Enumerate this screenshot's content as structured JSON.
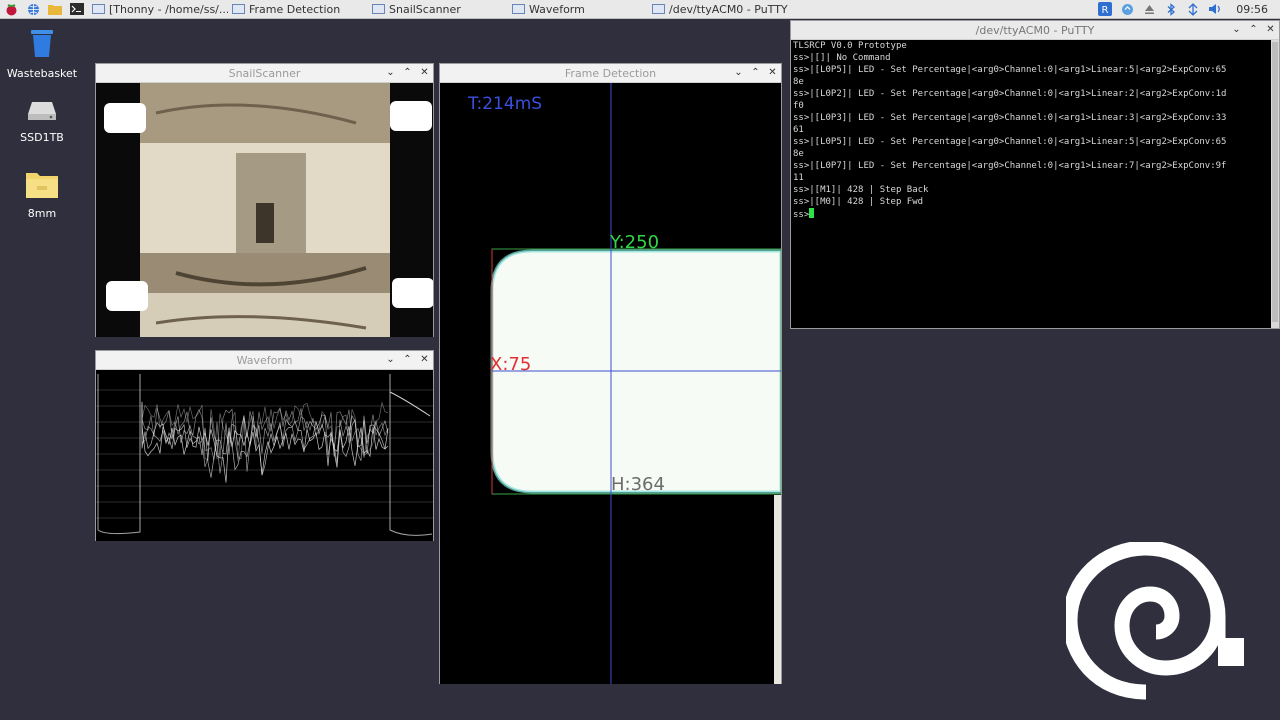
{
  "taskbar": {
    "tasks": [
      {
        "label": "[Thonny  -  /home/ss/..."
      },
      {
        "label": "Frame Detection"
      },
      {
        "label": "SnailScanner"
      },
      {
        "label": "Waveform"
      },
      {
        "label": "/dev/ttyACM0 - PuTTY"
      }
    ],
    "clock": "09:56"
  },
  "desktop": {
    "icons": [
      {
        "label": "Wastebasket"
      },
      {
        "label": "SSD1TB"
      },
      {
        "label": "8mm"
      }
    ]
  },
  "windows": {
    "snail": {
      "title": "SnailScanner"
    },
    "waveform": {
      "title": "Waveform"
    },
    "frame": {
      "title": "Frame Detection",
      "timing": "T:214mS",
      "y_label": "Y:250",
      "x_label": "X:75",
      "h_label": "H:364"
    },
    "putty": {
      "title": "/dev/ttyACM0 - PuTTY"
    }
  },
  "terminal": {
    "lines": [
      "TLSRCP V0.0 Prototype",
      "ss>|[]| No Command",
      "ss>|[L0P5]| LED - Set Percentage|<arg0>Channel:0|<arg1>Linear:5|<arg2>ExpConv:65",
      "8e",
      "ss>|[L0P2]| LED - Set Percentage|<arg0>Channel:0|<arg1>Linear:2|<arg2>ExpConv:1d",
      "f0",
      "ss>|[L0P3]| LED - Set Percentage|<arg0>Channel:0|<arg1>Linear:3|<arg2>ExpConv:33",
      "61",
      "ss>|[L0P5]| LED - Set Percentage|<arg0>Channel:0|<arg1>Linear:5|<arg2>ExpConv:65",
      "8e",
      "ss>|[L0P7]| LED - Set Percentage|<arg0>Channel:0|<arg1>Linear:7|<arg2>ExpConv:9f",
      "11",
      "ss>|[M1]| 428 | Step Back",
      "ss>|[M0]| 428 | Step Fwd"
    ],
    "prompt": "ss>"
  },
  "colors": {
    "desktop": "#2f2f3d",
    "timing_text": "#3b4fe0",
    "y_text": "#2fd64a",
    "x_text": "#e03030",
    "h_text": "#6c6c6c",
    "cursor": "#2ee34a"
  },
  "icons": {
    "menu": "raspberry-icon",
    "browser": "globe-icon",
    "files": "folder-icon",
    "terminal": "terminal-icon",
    "tray": [
      "realvnc-icon",
      "update-icon",
      "eject-icon",
      "bluetooth-icon",
      "network-icon",
      "volume-icon"
    ]
  }
}
